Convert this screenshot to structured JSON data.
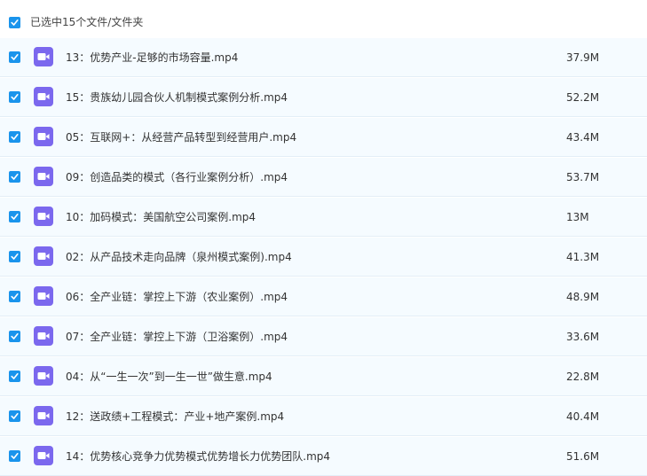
{
  "header": {
    "checked": true,
    "label": "已选中15个文件/文件夹"
  },
  "files": [
    {
      "name": "13：优势产业-足够的市场容量.mp4",
      "size": "37.9M",
      "checked": true,
      "icon": "video-file-icon"
    },
    {
      "name": "15：贵族幼儿园合伙人机制模式案例分析.mp4",
      "size": "52.2M",
      "checked": true,
      "icon": "video-file-icon"
    },
    {
      "name": "05：互联网+：从经营产品转型到经营用户.mp4",
      "size": "43.4M",
      "checked": true,
      "icon": "video-file-icon"
    },
    {
      "name": "09：创造品类的模式（各行业案例分析）.mp4",
      "size": "53.7M",
      "checked": true,
      "icon": "video-file-icon"
    },
    {
      "name": "10：加码模式：美国航空公司案例.mp4",
      "size": "13M",
      "checked": true,
      "icon": "video-file-icon"
    },
    {
      "name": "02：从产品技术走向品牌（泉州模式案例).mp4",
      "size": "41.3M",
      "checked": true,
      "icon": "video-file-icon"
    },
    {
      "name": "06：全产业链：掌控上下游（农业案例）.mp4",
      "size": "48.9M",
      "checked": true,
      "icon": "video-file-icon"
    },
    {
      "name": "07：全产业链：掌控上下游（卫浴案例）.mp4",
      "size": "33.6M",
      "checked": true,
      "icon": "video-file-icon"
    },
    {
      "name": "04：从“一生一次”到一生一世”做生意.mp4",
      "size": "22.8M",
      "checked": true,
      "icon": "video-file-icon"
    },
    {
      "name": "12：送政绩+工程模式：产业+地产案例.mp4",
      "size": "40.4M",
      "checked": true,
      "icon": "video-file-icon"
    },
    {
      "name": "14：优势核心竞争力优势模式优势增长力优势团队.mp4",
      "size": "51.6M",
      "checked": true,
      "icon": "video-file-icon"
    }
  ]
}
